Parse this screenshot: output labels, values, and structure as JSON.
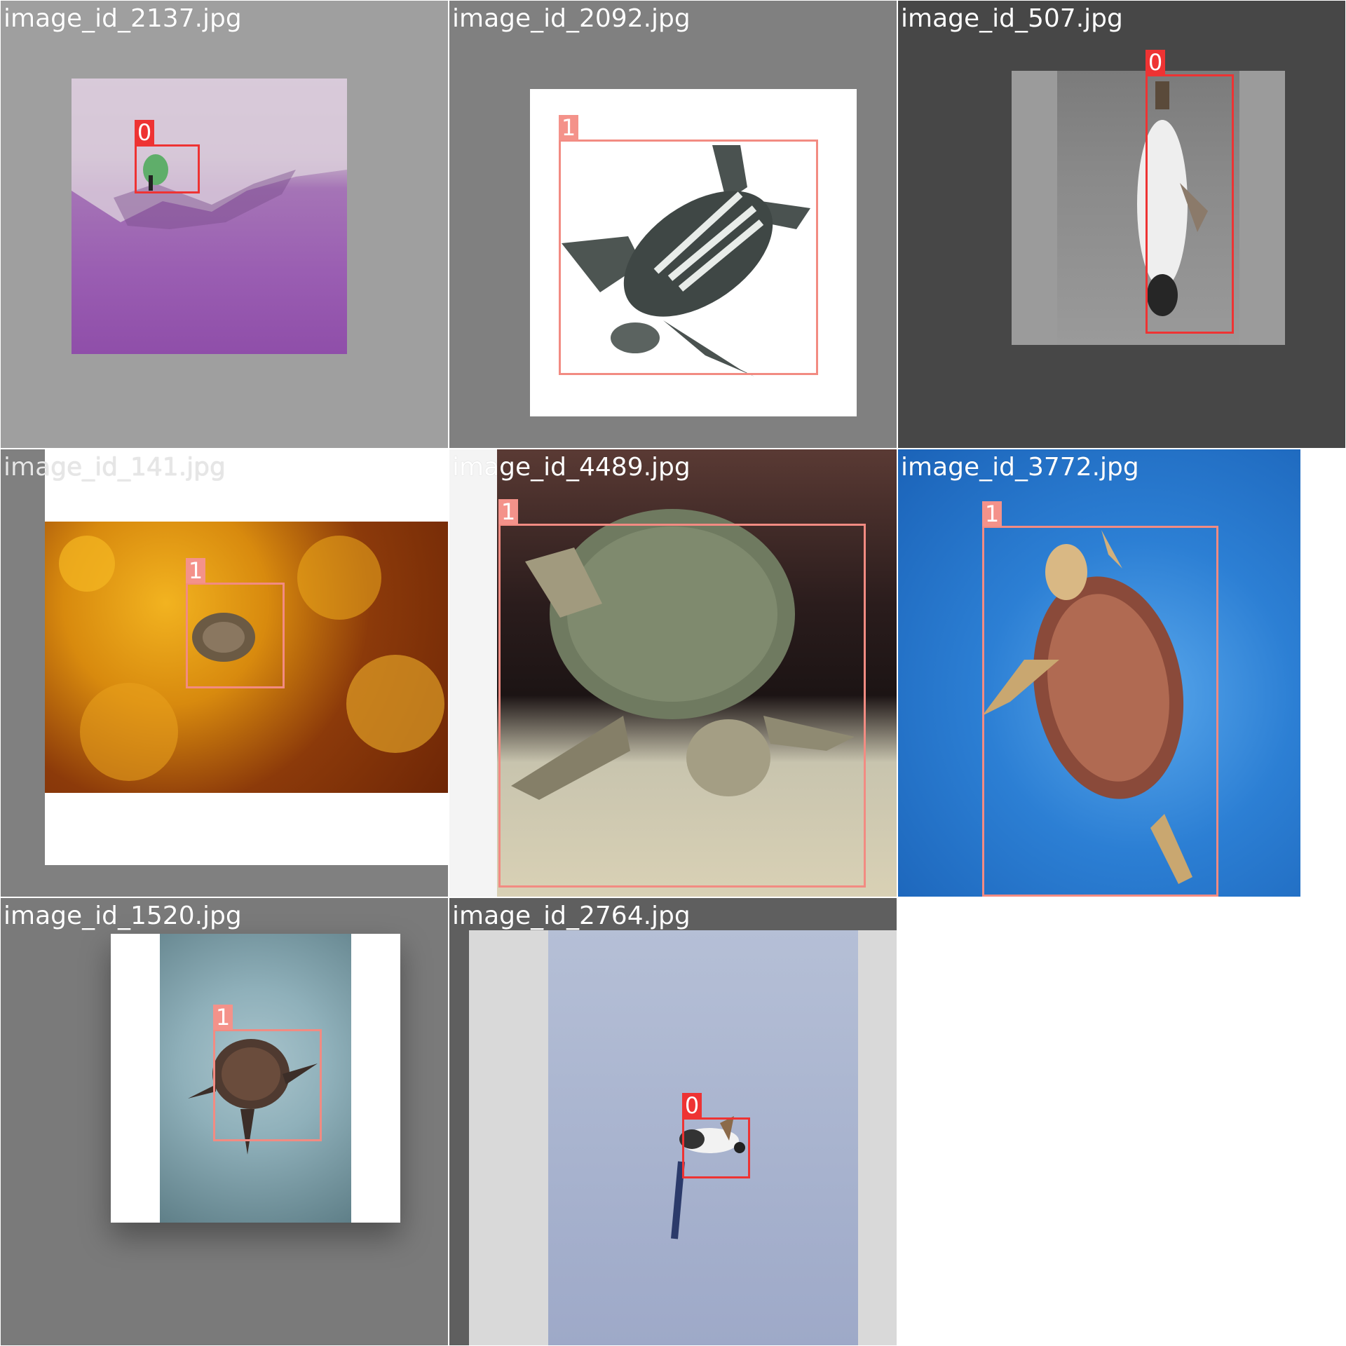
{
  "mosaic": {
    "tiles": [
      {
        "filename": "image_id_2137.jpg",
        "labels": [
          "0"
        ]
      },
      {
        "filename": "image_id_2092.jpg",
        "labels": [
          "1"
        ]
      },
      {
        "filename": "image_id_507.jpg",
        "labels": [
          "0"
        ]
      },
      {
        "filename": "image_id_141.jpg",
        "labels": [
          "1"
        ]
      },
      {
        "filename": "image_id_4489.jpg",
        "labels": [
          "1"
        ]
      },
      {
        "filename": "image_id_3772.jpg",
        "labels": [
          "1"
        ]
      },
      {
        "filename": "image_id_1520.jpg",
        "labels": [
          "1"
        ]
      },
      {
        "filename": "image_id_2764.jpg",
        "labels": [
          "0"
        ]
      }
    ],
    "colors": {
      "class_0_box": "#ee3333",
      "class_1_box": "#f28b82",
      "filename_text": "#ffffff"
    }
  }
}
